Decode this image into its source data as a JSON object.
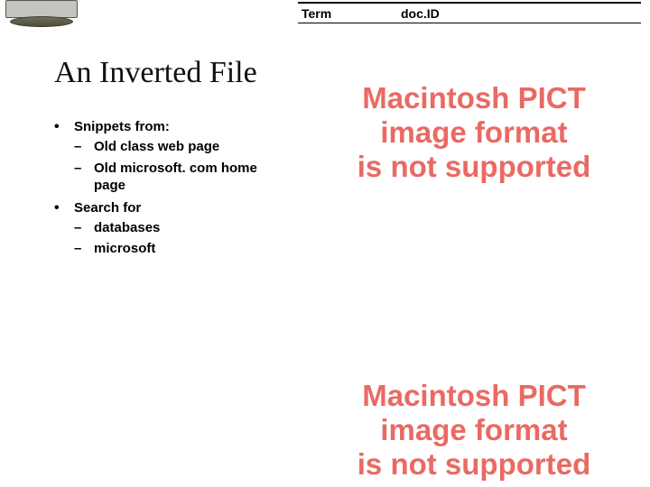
{
  "table": {
    "term_header": "Term",
    "docid_header": "doc.ID"
  },
  "title": "An Inverted File",
  "bullets": {
    "item1": {
      "label": "Snippets from:",
      "sub1": "Old class web page",
      "sub2": "Old microsoft. com home page"
    },
    "item2": {
      "label": "Search for",
      "sub1": "databases",
      "sub2": "microsoft"
    }
  },
  "pict_error": {
    "line1": "Macintosh PICT",
    "line2": "image format",
    "line3": "is not supported"
  }
}
